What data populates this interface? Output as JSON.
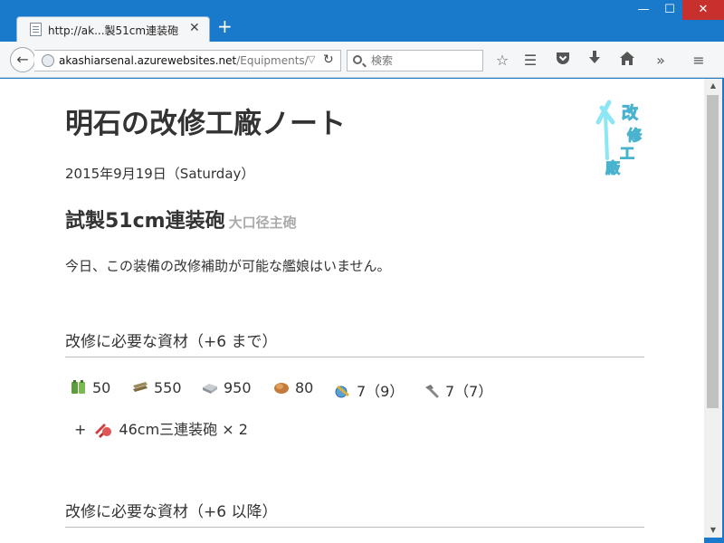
{
  "browser": {
    "tab_title": "http://ak...製51cm連装砲",
    "tab_close": "✕",
    "new_tab": "+",
    "win_min": "—",
    "win_max": "☐",
    "win_close": "✕",
    "url_host": "akashiarsenal.azurewebsites.net",
    "url_path": "/Equipments/",
    "search_placeholder": "検索",
    "accent": "#1979ca"
  },
  "page": {
    "site_title": "明石の改修工廠ノート",
    "date": "2015年9月19日（Saturday）",
    "equipment_name": "試製51cm連装砲",
    "equipment_type": "大口径主砲",
    "description": "今日、この装備の改修補助が可能な艦娘はいません。",
    "section1_title": "改修に必要な資材（+6 まで）",
    "section2_title": "改修に必要な資材（+6 以降）",
    "resources": [
      {
        "icon": "fuel-icon",
        "value": "50"
      },
      {
        "icon": "ammo-icon",
        "value": "550"
      },
      {
        "icon": "steel-icon",
        "value": "950"
      },
      {
        "icon": "bauxite-icon",
        "value": "80"
      },
      {
        "icon": "development-material-icon",
        "value": "7（9）"
      },
      {
        "icon": "improvement-material-icon",
        "value": "7（7）"
      }
    ],
    "consume_prefix": "+",
    "consume_item": "46cm三連装砲",
    "consume_count": "× 2",
    "logo_text": "改修工廠"
  }
}
